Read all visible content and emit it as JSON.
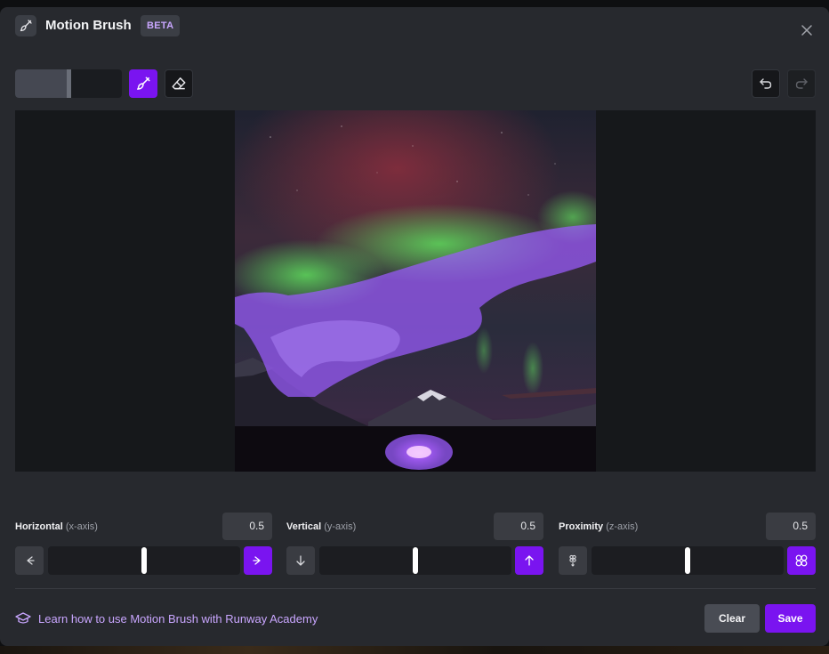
{
  "header": {
    "title": "Motion Brush",
    "badge": "BETA",
    "icon": "brush-icon",
    "close_icon": "close-icon"
  },
  "toolbar": {
    "brush_size_level": 0.48,
    "tools": [
      {
        "name": "brush",
        "icon": "brush-icon",
        "active": true
      },
      {
        "name": "eraser",
        "icon": "eraser-icon",
        "active": false
      }
    ],
    "undo_icon": "undo-icon",
    "redo_icon": "redo-icon"
  },
  "canvas": {
    "content": "aurora-over-mountains-with-car",
    "brush_color": "#9b5cff"
  },
  "controls": [
    {
      "label": "Horizontal",
      "axis": "(x-axis)",
      "value": "0.5",
      "level": 0.5,
      "neg_icon": "arrow-left-icon",
      "pos_icon": "arrow-right-icon"
    },
    {
      "label": "Vertical",
      "axis": "(y-axis)",
      "value": "0.5",
      "level": 0.5,
      "neg_icon": "arrow-down-icon",
      "pos_icon": "arrow-up-icon"
    },
    {
      "label": "Proximity",
      "axis": "(z-axis)",
      "value": "0.5",
      "level": 0.5,
      "neg_icon": "zoom-out-dots-icon",
      "pos_icon": "zoom-in-dots-icon"
    }
  ],
  "footer": {
    "academy_link": "Learn how to use Motion Brush with Runway Academy",
    "academy_icon": "graduation-cap-icon",
    "clear_label": "Clear",
    "save_label": "Save"
  },
  "colors": {
    "accent": "#7a14f0",
    "link": "#c9a6ff",
    "panel": "#27292e"
  }
}
